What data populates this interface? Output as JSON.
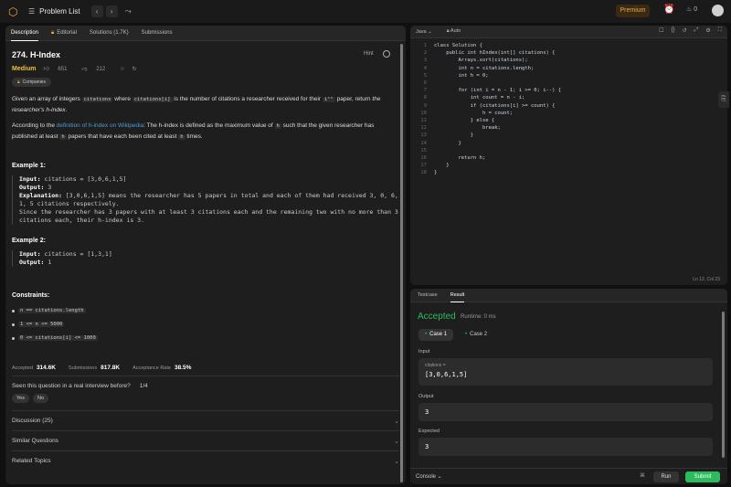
{
  "topbar": {
    "problem_list": "Problem List",
    "premium": "Premium",
    "streak": "0",
    "prev_icon": "chevron-left-icon",
    "next_icon": "chevron-right-icon",
    "shuffle_icon": "shuffle-icon"
  },
  "left_tabs": [
    "Description",
    "Editorial",
    "Solutions (1.7K)",
    "Submissions"
  ],
  "problem": {
    "title": "274. H-Index",
    "hint": "Hint",
    "difficulty": "Medium",
    "likes": "651",
    "dislikes": "212",
    "companies": "Companies"
  },
  "description": {
    "p1_a": "Given an array of integers ",
    "p1_code1": "citations",
    "p1_b": " where ",
    "p1_code2": "citations[i]",
    "p1_c": " is the number of citations a researcher received for their ",
    "p1_code3": "iᵗʰ",
    "p1_d": " paper, return ",
    "p1_e": "the researcher's h-index",
    "p1_f": ".",
    "p2_a": "According to the ",
    "p2_link": "definition of h-index on Wikipedia",
    "p2_b": ": The h-index is defined as the maximum value of ",
    "p2_code1": "h",
    "p2_c": " such that the given researcher has published at least ",
    "p2_code2": "h",
    "p2_d": " papers that have each been cited at least ",
    "p2_code3": "h",
    "p2_e": " times."
  },
  "examples": [
    {
      "heading": "Example 1:",
      "input_label": "Input:",
      "input": " citations = [3,0,6,1,5]",
      "output_label": "Output:",
      "output": " 3",
      "explanation_label": "Explanation:",
      "explanation": " [3,0,6,1,5] means the researcher has 5 papers in total and each of them had received 3, 0, 6, 1, 5 citations respectively.\nSince the researcher has 3 papers with at least 3 citations each and the remaining two with no more than 3 citations each, their h-index is 3."
    },
    {
      "heading": "Example 2:",
      "input_label": "Input:",
      "input": " citations = [1,3,1]",
      "output_label": "Output:",
      "output": " 1"
    }
  ],
  "constraints": {
    "heading": "Constraints:",
    "items": [
      "n == citations.length",
      "1 <= n <= 5000",
      "0 <= citations[i] <= 1000"
    ]
  },
  "stats": {
    "accepted_label": "Accepted",
    "accepted": "314.6K",
    "submissions_label": "Submissions",
    "submissions": "817.8K",
    "rate_label": "Acceptance Rate",
    "rate": "38.5%"
  },
  "seen": {
    "question": "Seen this question in a real interview before?",
    "count": "1/4",
    "yes": "Yes",
    "no": "No"
  },
  "accordions": [
    "Discussion (25)",
    "Similar Questions",
    "Related Topics"
  ],
  "editor": {
    "language": "Java",
    "mode": "Auto",
    "cursor": "Ln 12, Col 23",
    "lines": [
      "class Solution {",
      "    public int hIndex(int[] citations) {",
      "        Arrays.sort(citations);",
      "        int n = citations.length;",
      "        int h = 0;",
      "",
      "        for (int i = n - 1; i >= 0; i--) {",
      "            int count = n - i;",
      "            if (citations[i] >= count) {",
      "                h = count;",
      "            } else {",
      "                break;",
      "            }",
      "        }",
      "",
      "        return h;",
      "    }",
      "}"
    ]
  },
  "result": {
    "tabs": [
      "Testcase",
      "Result"
    ],
    "status": "Accepted",
    "runtime": "Runtime: 0 ms",
    "case1": "Case 1",
    "case2": "Case 2",
    "input_label": "Input",
    "input_var": "citations =",
    "input_value": "[3,0,6,1,5]",
    "output_label": "Output",
    "output_value": "3",
    "expected_label": "Expected",
    "expected_value": "3",
    "console": "Console",
    "run": "Run",
    "submit": "Submit"
  },
  "colors": {
    "accent": "#f0a83a",
    "accepted": "#2cbb5d",
    "medium": "#f0c23a",
    "link": "#4a9bd8"
  }
}
